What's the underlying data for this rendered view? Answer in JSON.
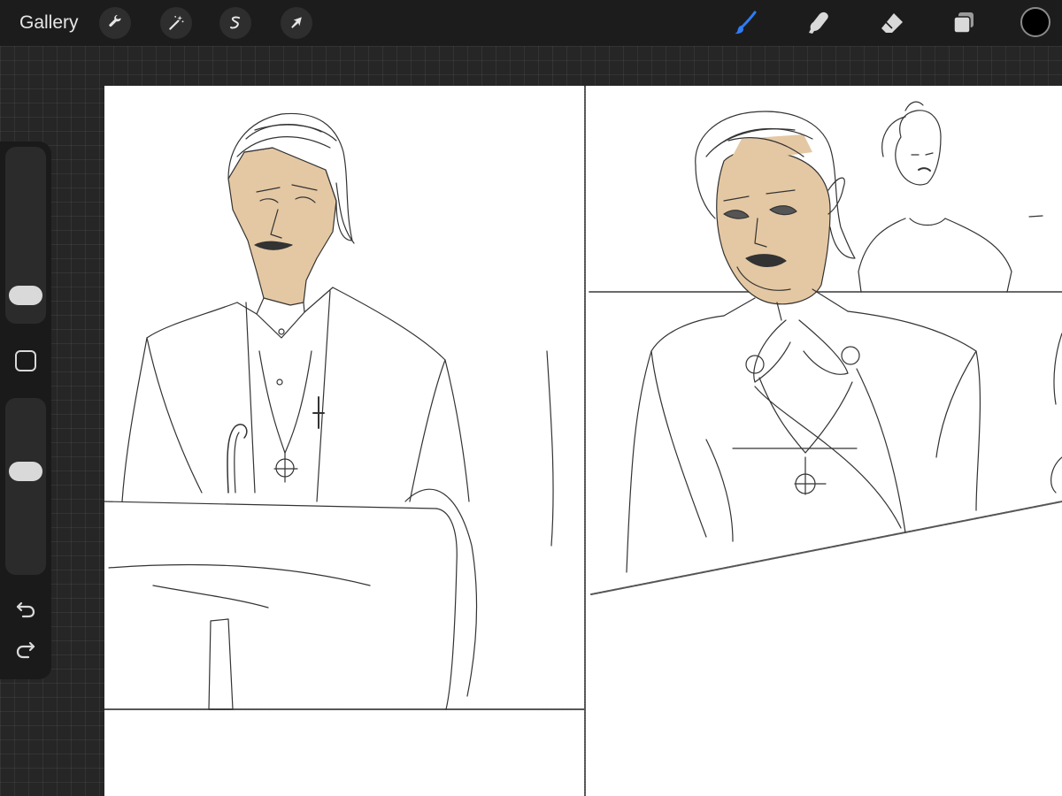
{
  "toolbar": {
    "gallery_label": "Gallery",
    "left_tools": [
      {
        "name": "actions",
        "icon": "wrench-icon"
      },
      {
        "name": "adjustments",
        "icon": "magic-wand-icon"
      },
      {
        "name": "selection",
        "icon": "selection-s-icon"
      },
      {
        "name": "transform",
        "icon": "arrow-cursor-icon"
      }
    ],
    "right_tools": [
      {
        "name": "brush",
        "icon": "brush-icon",
        "active": true
      },
      {
        "name": "smudge",
        "icon": "smudge-finger-icon",
        "active": false
      },
      {
        "name": "eraser",
        "icon": "eraser-icon",
        "active": false
      },
      {
        "name": "layers",
        "icon": "layers-icon",
        "active": false
      }
    ],
    "current_color": "#000000"
  },
  "sidebar": {
    "brush_size": 0.1,
    "brush_opacity": 0.6,
    "undo_icon": "undo-arrow-icon",
    "redo_icon": "redo-arrow-icon"
  },
  "colors": {
    "active_tool": "#2f7cf6",
    "skin_tone": "#e4c8a3",
    "ink": "#333333"
  }
}
